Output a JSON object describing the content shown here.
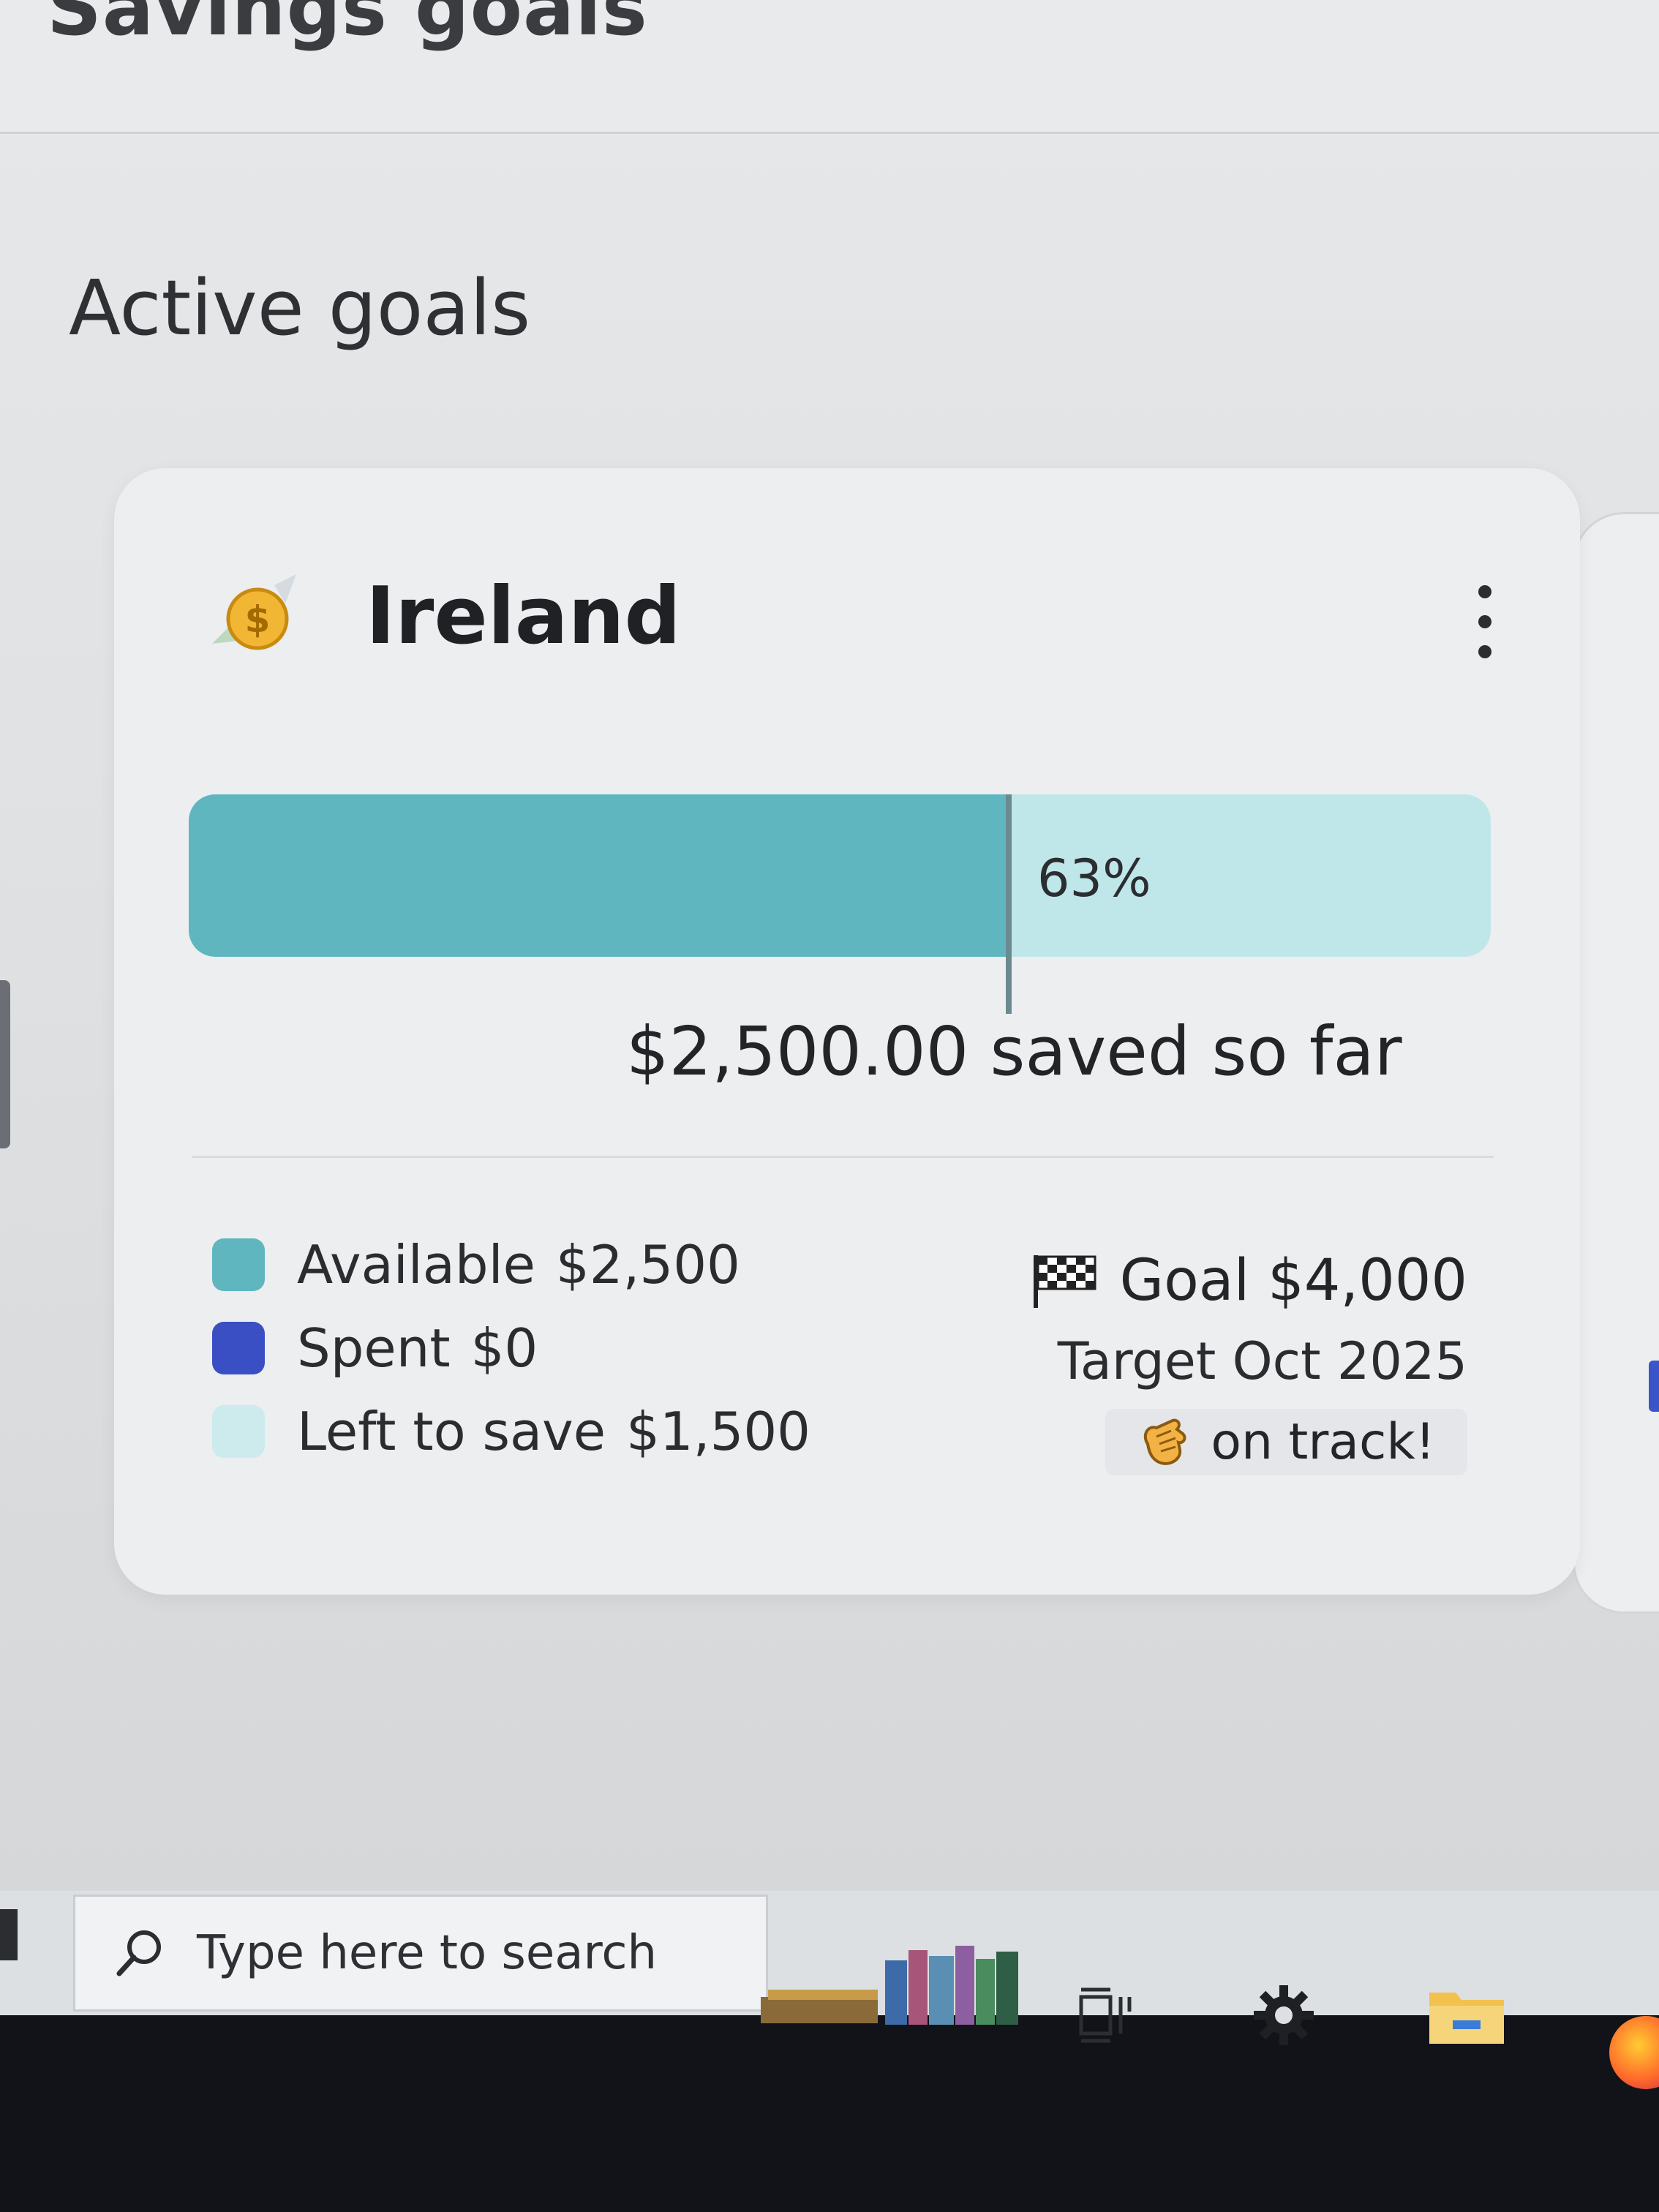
{
  "page": {
    "title": "Savings goals"
  },
  "section": {
    "title": "Active goals"
  },
  "goal": {
    "icon": "money-with-wings-icon",
    "name": "Ireland",
    "menu_icon": "more-vertical-icon",
    "progress": {
      "percent": 63,
      "label": "63%"
    },
    "saved_text": "$2,500.00 saved so far",
    "legend": [
      {
        "key": "available",
        "label": "Available",
        "value": "$2,500",
        "color": "#5fb6bf"
      },
      {
        "key": "spent",
        "label": "Spent",
        "value": "$0",
        "color": "#3a4fc4"
      },
      {
        "key": "left",
        "label": "Left to save",
        "value": "$1,500",
        "color": "#bfe7ea"
      }
    ],
    "goal_text": "Goal $4,000",
    "goal_icon": "checkered-flag-icon",
    "target_text": "Target Oct 2025",
    "status_text": "on track!",
    "status_icon": "clapping-hands-icon"
  },
  "taskbar": {
    "search_placeholder": "Type here to search",
    "icons": [
      "search-icon",
      "books-icon",
      "task-view-icon",
      "settings-gear-icon",
      "file-explorer-icon",
      "firefox-icon"
    ]
  }
}
